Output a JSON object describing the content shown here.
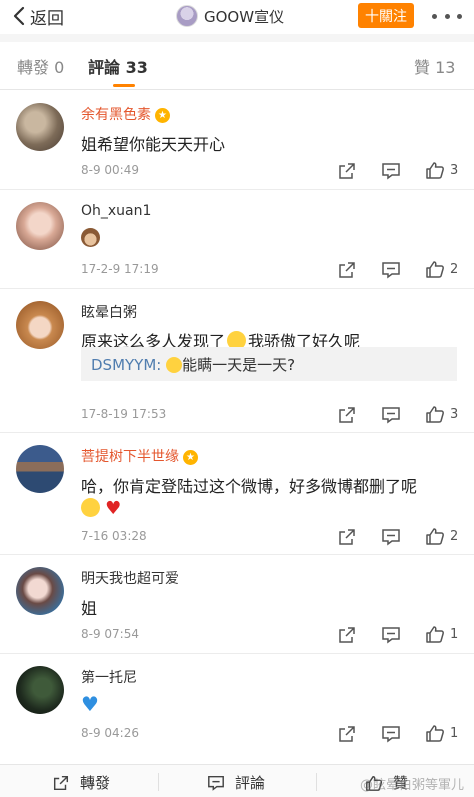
{
  "topbar": {
    "back_label": "返回",
    "title": "GOOW宣仪",
    "follow_label": "十關注",
    "follow_color": "#ff8200"
  },
  "tabs": {
    "repost_label": "轉發 0",
    "comments_label": "評論 33",
    "likes_label": "贊 13",
    "active": "comments"
  },
  "comments": [
    {
      "username": "余有黑色素",
      "vip": true,
      "text": "姐希望你能天天开心",
      "time": "8-9 00:49",
      "likes": "3"
    },
    {
      "username": "Oh_xuan1",
      "vip": false,
      "text": "",
      "emoji": "monkey-emoji",
      "time": "17-2-9 17:19",
      "likes": "2"
    },
    {
      "username": "眩晕白粥",
      "vip": false,
      "text_before": "原来这么多人发现了",
      "text_after": "我骄傲了好久呢",
      "reply_name": "DSMYYM:",
      "reply_text": "能瞒一天是一天?",
      "time": "17-8-19 17:53",
      "likes": "3"
    },
    {
      "username": "菩提树下半世缘",
      "vip": true,
      "text": "哈，你肯定登陆过这个微博，好多微博都删了呢",
      "time": "7-16 03:28",
      "likes": "2"
    },
    {
      "username": "明天我也超可爱",
      "vip": false,
      "text": "姐",
      "time": "8-9 07:54",
      "likes": "1"
    },
    {
      "username": "第一托尼",
      "vip": false,
      "text": "",
      "emoji": "blue-heart-emoji",
      "time": "8-9 04:26",
      "likes": "1"
    }
  ],
  "bottombar": {
    "repost_label": "轉發",
    "comment_label": "評論",
    "like_label": "贊"
  },
  "watermark": "@眩晕白粥等軍儿",
  "icons": [
    "back-arrow-icon",
    "more-icon",
    "share-icon",
    "comment-icon",
    "thumbs-up-icon"
  ]
}
